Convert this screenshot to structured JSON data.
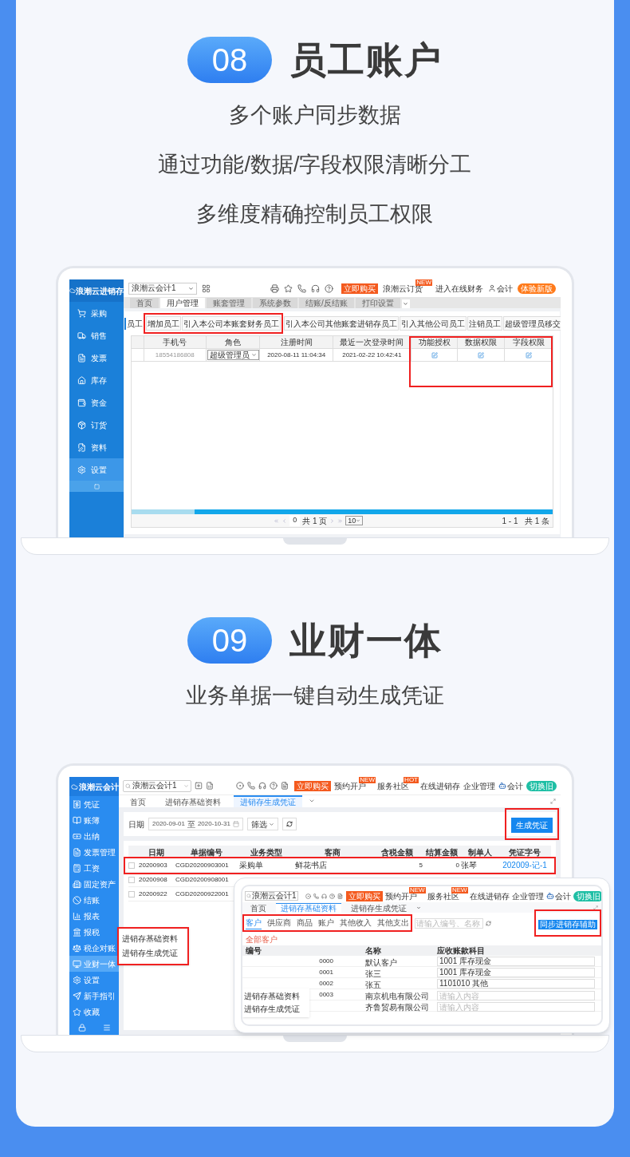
{
  "section_1": {
    "number": "08",
    "title": "员工账户",
    "subtitles": [
      "多个账户同步数据",
      "通过功能/数据/字段权限清晰分工",
      "多维度精确控制员工权限"
    ],
    "app": {
      "logo": "浪潮云进销存",
      "account": "浪潮云会计1",
      "header_links": [
        {
          "kind": "buy",
          "label": "立即购买"
        },
        {
          "kind": "link",
          "label": "浪潮云订货",
          "badge": "NEW"
        },
        {
          "kind": "link",
          "label": "进入在线财务"
        },
        {
          "kind": "user",
          "label": "会计"
        },
        {
          "kind": "pill",
          "label": "体验新版"
        }
      ],
      "sidebar": [
        {
          "label": "采购",
          "selected": false
        },
        {
          "label": "销售",
          "selected": false
        },
        {
          "label": "发票",
          "selected": false
        },
        {
          "label": "库存",
          "selected": false
        },
        {
          "label": "资金",
          "selected": false
        },
        {
          "label": "订货",
          "selected": false
        },
        {
          "label": "资料",
          "selected": false
        },
        {
          "label": "设置",
          "selected": true
        }
      ],
      "tabs": [
        {
          "label": "首页",
          "selected": false
        },
        {
          "label": "用户管理",
          "selected": true
        },
        {
          "label": "账套管理",
          "selected": false
        },
        {
          "label": "系统参数",
          "selected": false
        },
        {
          "label": "结账/反结账",
          "selected": false
        },
        {
          "label": "打印设置",
          "selected": false
        }
      ],
      "section_label": "员工",
      "buttons": [
        {
          "label": "增加员工",
          "highlighted": true
        },
        {
          "label": "引入本公司本账套财务员工",
          "highlighted": true
        },
        {
          "label": "引入本公司其他账套进销存员工",
          "highlighted": false
        },
        {
          "label": "引入其他公司员工",
          "highlighted": false
        },
        {
          "label": "注销员工",
          "highlighted": false
        },
        {
          "label": "超级管理员移交",
          "highlighted": false
        }
      ],
      "table": {
        "columns": [
          "手机号",
          "角色",
          "注册时间",
          "最近一次登录时间",
          "功能授权",
          "数据权限",
          "字段权限"
        ],
        "rows": [
          {
            "phone": "18554186808",
            "role": "超级管理员",
            "registered": "2020-08-11 11:04:34",
            "last_login": "2021-02-22 10:42:41"
          }
        ]
      },
      "pager": {
        "page": "0",
        "pages": "共 1 页",
        "page_size": "10",
        "summary": "1 - 1   共 1 条"
      }
    }
  },
  "section_2": {
    "number": "09",
    "title": "业财一体",
    "subtitles": [
      "业务单据一键自动生成凭证"
    ],
    "app": {
      "logo": "浪潮云会计",
      "account": "浪潮云会计1",
      "header_links": [
        {
          "kind": "buy",
          "label": "立即购买"
        },
        {
          "kind": "link",
          "label": "预约开户",
          "badge": "NEW"
        },
        {
          "kind": "link",
          "label": "服务社区",
          "badge": "HOT"
        },
        {
          "kind": "link",
          "label": "在线进销存"
        },
        {
          "kind": "link",
          "label": "企业管理"
        },
        {
          "kind": "user",
          "label": "会计"
        },
        {
          "kind": "pill",
          "label": "切换旧"
        }
      ],
      "sidebar": [
        {
          "label": "凭证",
          "selected": false
        },
        {
          "label": "账簿",
          "selected": false
        },
        {
          "label": "出纳",
          "selected": false
        },
        {
          "label": "发票管理",
          "selected": false
        },
        {
          "label": "工资",
          "selected": false
        },
        {
          "label": "固定资产",
          "selected": false
        },
        {
          "label": "结账",
          "selected": false
        },
        {
          "label": "报表",
          "selected": false
        },
        {
          "label": "报税",
          "selected": false
        },
        {
          "label": "税企对账",
          "selected": false
        },
        {
          "label": "业财一体",
          "selected": true
        },
        {
          "label": "设置",
          "selected": false
        },
        {
          "label": "新手指引",
          "selected": false
        },
        {
          "label": "收藏",
          "selected": false
        }
      ],
      "tabs": [
        {
          "label": "首页",
          "selected": false
        },
        {
          "label": "进销存基础资料",
          "selected": false
        },
        {
          "label": "进销存生成凭证",
          "selected": true
        }
      ],
      "date_label": "日期",
      "date_from": "2020-09-01",
      "date_sep": "至",
      "date_to": "2020-10-31",
      "filter": "筛选",
      "generate_button": "生成凭证",
      "table": {
        "columns": [
          "日期",
          "单据编号",
          "业务类型",
          "客商",
          "含税金额",
          "结算金额",
          "制单人",
          "凭证字号"
        ],
        "rows": [
          {
            "checked": false,
            "highlighted": true,
            "cells": [
              "20200903",
              "CGD20200903001",
              "采购单",
              "鲜花书店",
              "5",
              "0",
              "张琴",
              "202009-记-1"
            ]
          },
          {
            "checked": false,
            "highlighted": false,
            "cells": [
              "20200908",
              "CGD20200908001"
            ]
          },
          {
            "checked": false,
            "highlighted": false,
            "cells": [
              "20200922",
              "CGD20200922001"
            ]
          }
        ]
      },
      "flyout": [
        "进销存基础资料",
        "进销存生成凭证"
      ]
    },
    "inset_app": {
      "account": "浪潮云会计1",
      "header_links": [
        {
          "kind": "buy",
          "label": "立即购买"
        },
        {
          "kind": "link",
          "label": "预约开户",
          "badge": "NEW"
        },
        {
          "kind": "link",
          "label": "服务社区",
          "badge": "NEW"
        },
        {
          "kind": "link",
          "label": "在线进销存"
        },
        {
          "kind": "link",
          "label": "企业管理"
        },
        {
          "kind": "user",
          "label": "会计"
        },
        {
          "kind": "pill",
          "label": "切换旧"
        }
      ],
      "tabs": [
        {
          "label": "首页",
          "selected": false
        },
        {
          "label": "进销存基础资料",
          "selected": true
        },
        {
          "label": "进销存生成凭证",
          "selected": false
        }
      ],
      "subtabs": [
        {
          "label": "客户",
          "selected": true
        },
        {
          "label": "供应商",
          "selected": false
        },
        {
          "label": "商品",
          "selected": false
        },
        {
          "label": "账户",
          "selected": false
        },
        {
          "label": "其他收入",
          "selected": false
        },
        {
          "label": "其他支出",
          "selected": false
        }
      ],
      "search_placeholder": "请输入编号、名称",
      "sync_button": "同步进销存辅助",
      "filter_text": "全部客户",
      "table": {
        "columns": [
          "编号",
          "名称",
          "应收账款科目"
        ],
        "rows": [
          {
            "code": "0000",
            "name": "默认客户",
            "subject": "1001 库存现金"
          },
          {
            "code": "0001",
            "name": "张三",
            "subject": "1001 库存现金"
          },
          {
            "code": "0002",
            "name": "张五",
            "subject": "1101010 其他"
          },
          {
            "code": "0003",
            "name": "南京机电有限公司",
            "subject_placeholder": "请输入内容"
          },
          {
            "code": "",
            "name": "齐鲁贸易有限公司",
            "subject_placeholder": "请输入内容"
          }
        ]
      },
      "flyout": [
        "进销存基础资料",
        "进销存生成凭证"
      ]
    }
  }
}
